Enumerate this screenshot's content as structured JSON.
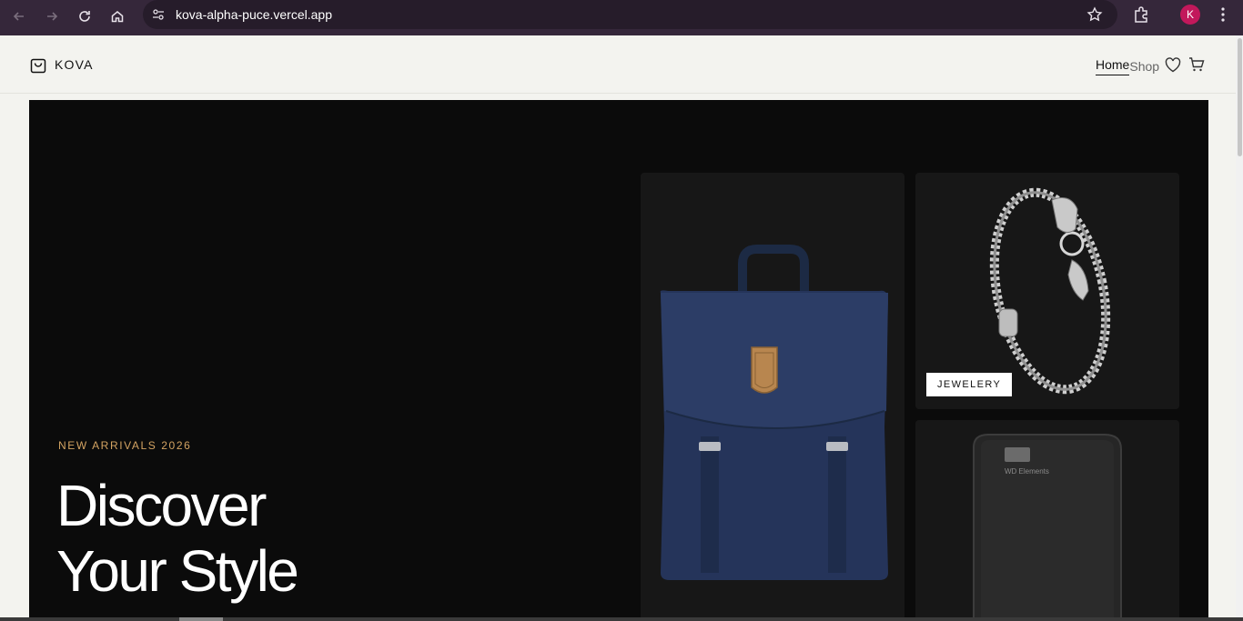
{
  "browser": {
    "url": "kova-alpha-puce.vercel.app",
    "profile_initial": "K",
    "icons": [
      "back-icon",
      "forward-icon",
      "reload-icon",
      "home-icon",
      "site-settings-icon",
      "bookmark-star-icon",
      "extensions-icon",
      "menu-kebab-icon"
    ],
    "colors": {
      "frame": "#35273a",
      "urlbar": "#261c2a",
      "avatar": "#c2185b"
    }
  },
  "header": {
    "logo_text": "KOVA",
    "nav": {
      "home": "Home",
      "shop": "Shop"
    },
    "icons": [
      "shopping-bag-icon",
      "heart-icon",
      "cart-icon"
    ]
  },
  "hero": {
    "eyebrow": "NEW ARRIVALS 2026",
    "headline_line1": "Discover",
    "headline_line2": "Your Style",
    "colors": {
      "background": "#0b0b0b",
      "accent": "#d3a362"
    },
    "tiles": {
      "jewelery_tag": "JEWELERY",
      "drive_label": "WD Elements"
    }
  }
}
